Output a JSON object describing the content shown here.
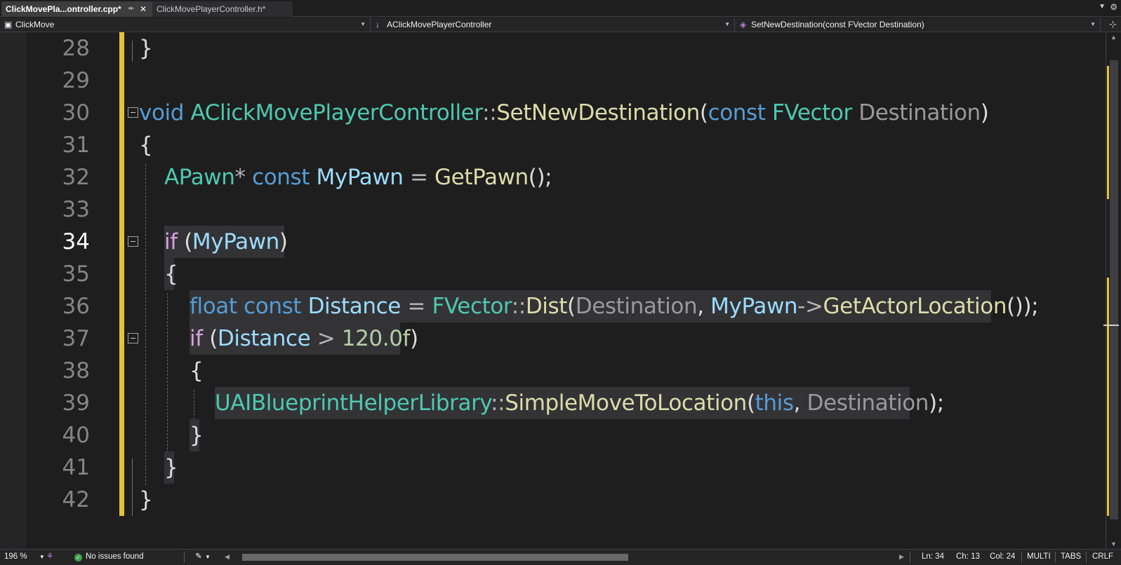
{
  "tabs": [
    {
      "label": "ClickMovePla...ontroller.cpp*",
      "active": true
    },
    {
      "label": "ClickMovePlayerController.h*",
      "active": false
    }
  ],
  "nav": {
    "project": "ClickMove",
    "class_scope": "AClickMovePlayerController",
    "member": "SetNewDestination(const FVector Destination)"
  },
  "editor": {
    "current_line": 34,
    "lines": [
      {
        "n": "28",
        "text": "}"
      },
      {
        "n": "29",
        "text": ""
      },
      {
        "n": "30",
        "text": "void AClickMovePlayerController::SetNewDestination(const FVector Destination)"
      },
      {
        "n": "31",
        "text": "{"
      },
      {
        "n": "32",
        "text": "APawn* const MyPawn = GetPawn();"
      },
      {
        "n": "33",
        "text": ""
      },
      {
        "n": "34",
        "text": "if (MyPawn)"
      },
      {
        "n": "35",
        "text": "{"
      },
      {
        "n": "36",
        "text": "float const Distance = FVector::Dist(Destination, MyPawn->GetActorLocation());"
      },
      {
        "n": "37",
        "text": "if (Distance > 120.0f)"
      },
      {
        "n": "38",
        "text": "{"
      },
      {
        "n": "39",
        "text": "UAIBlueprintHelperLibrary::SimpleMoveToLocation(this, Destination);"
      },
      {
        "n": "40",
        "text": "}"
      },
      {
        "n": "41",
        "text": "}"
      },
      {
        "n": "42",
        "text": "}"
      }
    ]
  },
  "status": {
    "zoom": "196 %",
    "issues": "No issues found",
    "ln": "Ln: 34",
    "ch": "Ch: 13",
    "col": "Col: 24",
    "selection_mode": "MULTI",
    "indent": "TABS",
    "line_endings": "CRLF"
  },
  "colors": {
    "keyword": "#569cd6",
    "control": "#d8a0df",
    "type": "#4ec9b0",
    "function": "#dcdcaa",
    "variable": "#9cdcfe",
    "parameter": "#9a9a9a",
    "number": "#b5cea8",
    "change_bar": "#e6c23b"
  }
}
